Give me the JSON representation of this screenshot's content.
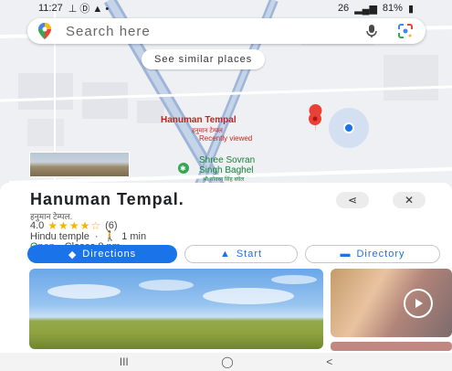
{
  "status_bar": {
    "time": "11:27",
    "left_extra": "⊥ Ⓓ ▲ •",
    "right_extra": "26",
    "battery": "81%"
  },
  "search": {
    "placeholder": "Search here"
  },
  "map": {
    "similar_chip": "See similar places",
    "pin_title": "Hanuman Tempal",
    "pin_subtitle": "हनुमान टेम्पल",
    "pin_recent": "Recently viewed",
    "nearby_name_line1": "Shree Sovran",
    "nearby_name_line2": "Singh Baghel",
    "nearby_sub": "श्री सोवरन सिंह बघेल"
  },
  "place": {
    "title": "Hanuman Tempal.",
    "subtitle": "हनुमान टेम्पल.",
    "rating": "4.0",
    "stars": "★★★★☆",
    "review_count": "(6)",
    "category": "Hindu temple",
    "drive_time": "1 min",
    "open_status": "Open",
    "closes": "· Closes 8 pm"
  },
  "actions": {
    "directions": "Directions",
    "start": "Start",
    "directory": "Directory"
  },
  "nav": {
    "recents": "III",
    "home": "◯",
    "back": "<"
  },
  "colors": {
    "accent": "#1a73e8",
    "open": "#188038",
    "pin": "#c5221f"
  }
}
